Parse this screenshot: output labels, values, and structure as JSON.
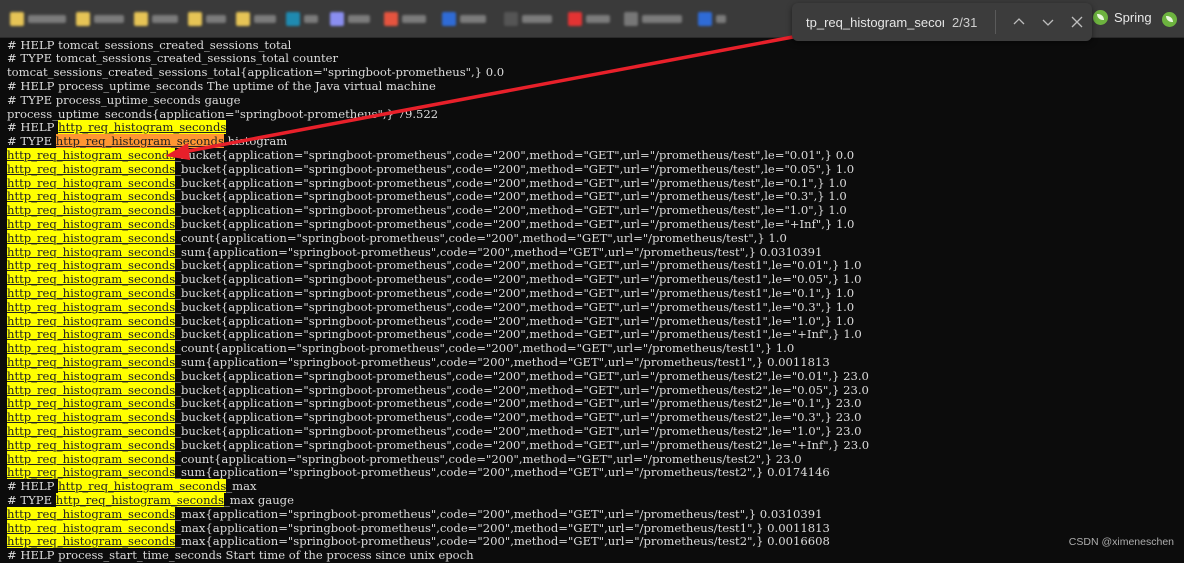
{
  "bookmark_bar": {
    "blurred_items": [
      {
        "icon_color": "#e6c456",
        "label_w": 38
      },
      {
        "icon_color": "#e6c456",
        "label_w": 30
      },
      {
        "icon_color": "#e6c456",
        "label_w": 26
      },
      {
        "icon_color": "#e6c456",
        "label_w": 20
      },
      {
        "icon_color": "#e6c456",
        "label_w": 22
      },
      {
        "icon_color": "#1f8ab0",
        "label_w": 14
      },
      {
        "icon_color": "#8a8ef0",
        "label_w": 22
      },
      {
        "icon_color": "#e5543f",
        "label_w": 24
      },
      {
        "icon_color": "#2f6bd6",
        "label_w": 26
      },
      {
        "icon_color": "#555555",
        "label_w": 30
      },
      {
        "icon_color": "#e33333",
        "label_w": 24
      },
      {
        "icon_color": "#777777",
        "label_w": 40
      },
      {
        "icon_color": "#2f6bd6",
        "label_w": 10
      }
    ],
    "spring_label": "Spring"
  },
  "find_bar": {
    "query": "tp_req_histogram_seconds",
    "match_count": "2/31",
    "prev_label": "Previous match",
    "next_label": "Next match",
    "close_label": "Close"
  },
  "highlight_term": "http_req_histogram_seconds",
  "lines": [
    {
      "pre": "# HELP tomcat_sessions_created_sessions_total",
      "hl": "",
      "post": ""
    },
    {
      "pre": "# TYPE tomcat_sessions_created_sessions_total counter",
      "hl": "",
      "post": ""
    },
    {
      "pre": "tomcat_sessions_created_sessions_total{application=\"springboot-prometheus\",} 0.0",
      "hl": "",
      "post": ""
    },
    {
      "pre": "# HELP process_uptime_seconds The uptime of the Java virtual machine",
      "hl": "",
      "post": ""
    },
    {
      "pre": "# TYPE process_uptime_seconds gauge",
      "hl": "",
      "post": ""
    },
    {
      "pre": "process_uptime_seconds{application=\"springboot-prometheus\",} 79.522",
      "hl": "",
      "post": ""
    },
    {
      "pre": "# HELP ",
      "hl": "yellow",
      "post": ""
    },
    {
      "pre": "# TYPE ",
      "hl": "orange",
      "post": " histogram"
    },
    {
      "pre": "",
      "hl": "yellow",
      "post": "_bucket{application=\"springboot-prometheus\",code=\"200\",method=\"GET\",url=\"/prometheus/test\",le=\"0.01\",} 0.0"
    },
    {
      "pre": "",
      "hl": "yellow",
      "post": "_bucket{application=\"springboot-prometheus\",code=\"200\",method=\"GET\",url=\"/prometheus/test\",le=\"0.05\",} 1.0"
    },
    {
      "pre": "",
      "hl": "yellow",
      "post": "_bucket{application=\"springboot-prometheus\",code=\"200\",method=\"GET\",url=\"/prometheus/test\",le=\"0.1\",} 1.0"
    },
    {
      "pre": "",
      "hl": "yellow",
      "post": "_bucket{application=\"springboot-prometheus\",code=\"200\",method=\"GET\",url=\"/prometheus/test\",le=\"0.3\",} 1.0"
    },
    {
      "pre": "",
      "hl": "yellow",
      "post": "_bucket{application=\"springboot-prometheus\",code=\"200\",method=\"GET\",url=\"/prometheus/test\",le=\"1.0\",} 1.0"
    },
    {
      "pre": "",
      "hl": "yellow",
      "post": "_bucket{application=\"springboot-prometheus\",code=\"200\",method=\"GET\",url=\"/prometheus/test\",le=\"+Inf\",} 1.0"
    },
    {
      "pre": "",
      "hl": "yellow",
      "post": "_count{application=\"springboot-prometheus\",code=\"200\",method=\"GET\",url=\"/prometheus/test\",} 1.0"
    },
    {
      "pre": "",
      "hl": "yellow",
      "post": "_sum{application=\"springboot-prometheus\",code=\"200\",method=\"GET\",url=\"/prometheus/test\",} 0.0310391"
    },
    {
      "pre": "",
      "hl": "yellow",
      "post": "_bucket{application=\"springboot-prometheus\",code=\"200\",method=\"GET\",url=\"/prometheus/test1\",le=\"0.01\",} 1.0"
    },
    {
      "pre": "",
      "hl": "yellow",
      "post": "_bucket{application=\"springboot-prometheus\",code=\"200\",method=\"GET\",url=\"/prometheus/test1\",le=\"0.05\",} 1.0"
    },
    {
      "pre": "",
      "hl": "yellow",
      "post": "_bucket{application=\"springboot-prometheus\",code=\"200\",method=\"GET\",url=\"/prometheus/test1\",le=\"0.1\",} 1.0"
    },
    {
      "pre": "",
      "hl": "yellow",
      "post": "_bucket{application=\"springboot-prometheus\",code=\"200\",method=\"GET\",url=\"/prometheus/test1\",le=\"0.3\",} 1.0"
    },
    {
      "pre": "",
      "hl": "yellow",
      "post": "_bucket{application=\"springboot-prometheus\",code=\"200\",method=\"GET\",url=\"/prometheus/test1\",le=\"1.0\",} 1.0"
    },
    {
      "pre": "",
      "hl": "yellow",
      "post": "_bucket{application=\"springboot-prometheus\",code=\"200\",method=\"GET\",url=\"/prometheus/test1\",le=\"+Inf\",} 1.0"
    },
    {
      "pre": "",
      "hl": "yellow",
      "post": "_count{application=\"springboot-prometheus\",code=\"200\",method=\"GET\",url=\"/prometheus/test1\",} 1.0"
    },
    {
      "pre": "",
      "hl": "yellow",
      "post": "_sum{application=\"springboot-prometheus\",code=\"200\",method=\"GET\",url=\"/prometheus/test1\",} 0.0011813"
    },
    {
      "pre": "",
      "hl": "yellow",
      "post": "_bucket{application=\"springboot-prometheus\",code=\"200\",method=\"GET\",url=\"/prometheus/test2\",le=\"0.01\",} 23.0"
    },
    {
      "pre": "",
      "hl": "yellow",
      "post": "_bucket{application=\"springboot-prometheus\",code=\"200\",method=\"GET\",url=\"/prometheus/test2\",le=\"0.05\",} 23.0"
    },
    {
      "pre": "",
      "hl": "yellow",
      "post": "_bucket{application=\"springboot-prometheus\",code=\"200\",method=\"GET\",url=\"/prometheus/test2\",le=\"0.1\",} 23.0"
    },
    {
      "pre": "",
      "hl": "yellow",
      "post": "_bucket{application=\"springboot-prometheus\",code=\"200\",method=\"GET\",url=\"/prometheus/test2\",le=\"0.3\",} 23.0"
    },
    {
      "pre": "",
      "hl": "yellow",
      "post": "_bucket{application=\"springboot-prometheus\",code=\"200\",method=\"GET\",url=\"/prometheus/test2\",le=\"1.0\",} 23.0"
    },
    {
      "pre": "",
      "hl": "yellow",
      "post": "_bucket{application=\"springboot-prometheus\",code=\"200\",method=\"GET\",url=\"/prometheus/test2\",le=\"+Inf\",} 23.0"
    },
    {
      "pre": "",
      "hl": "yellow",
      "post": "_count{application=\"springboot-prometheus\",code=\"200\",method=\"GET\",url=\"/prometheus/test2\",} 23.0"
    },
    {
      "pre": "",
      "hl": "yellow",
      "post": "_sum{application=\"springboot-prometheus\",code=\"200\",method=\"GET\",url=\"/prometheus/test2\",} 0.0174146"
    },
    {
      "pre": "# HELP ",
      "hl": "yellow",
      "post": "_max"
    },
    {
      "pre": "# TYPE ",
      "hl": "yellow",
      "post": "_max gauge"
    },
    {
      "pre": "",
      "hl": "yellow",
      "post": "_max{application=\"springboot-prometheus\",code=\"200\",method=\"GET\",url=\"/prometheus/test\",} 0.0310391"
    },
    {
      "pre": "",
      "hl": "yellow",
      "post": "_max{application=\"springboot-prometheus\",code=\"200\",method=\"GET\",url=\"/prometheus/test1\",} 0.0011813"
    },
    {
      "pre": "",
      "hl": "yellow",
      "post": "_max{application=\"springboot-prometheus\",code=\"200\",method=\"GET\",url=\"/prometheus/test2\",} 0.0016608"
    },
    {
      "pre": "# HELP process_start_time_seconds Start time of the process since unix epoch",
      "hl": "",
      "post": ""
    }
  ],
  "watermark": "CSDN @ximeneschen",
  "annotation_color": "#e8202a"
}
